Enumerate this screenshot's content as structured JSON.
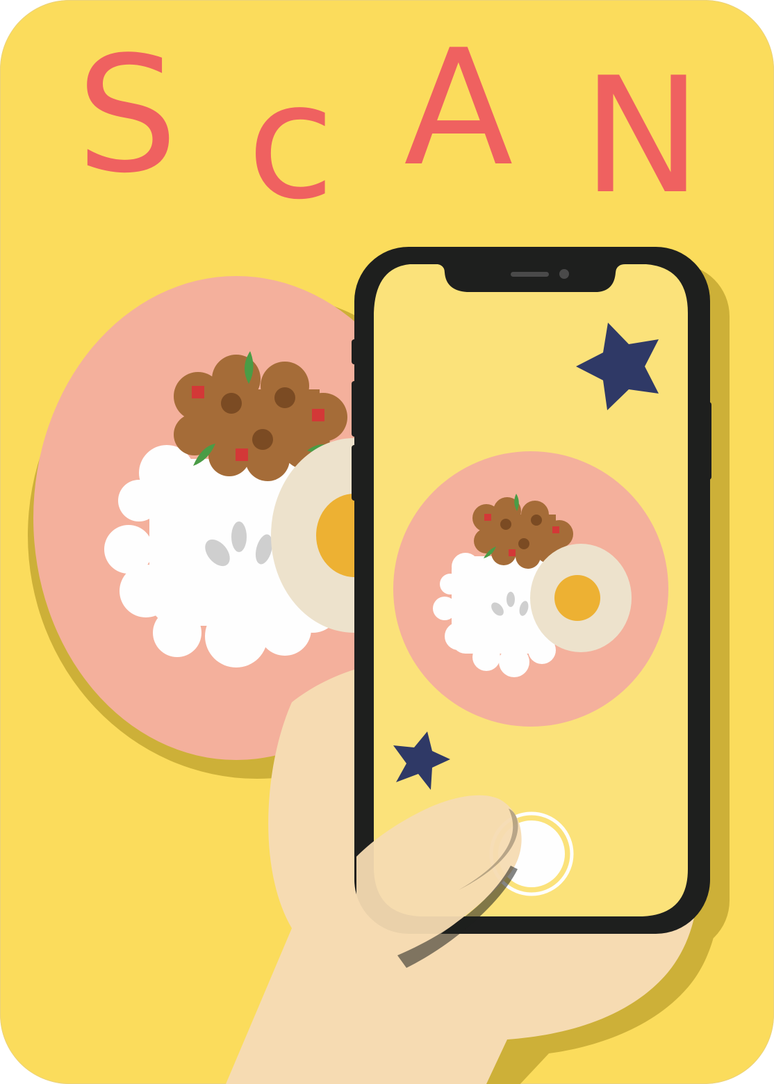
{
  "title": {
    "text": "SCAN",
    "letters": [
      "S",
      "c",
      "A",
      "N"
    ]
  },
  "colors": {
    "background": "#fbdc5c",
    "title": "#ef6160",
    "plate": "#f4b09c",
    "plate_shadow": "#cdb038",
    "rice": "#fefefe",
    "meat": "#a56c38",
    "egg_white": "#ede2cc",
    "egg_yolk": "#edb133",
    "phone_body": "#1e1f1e",
    "phone_screen": "#fbe27a",
    "star": "#2f3966",
    "hand": "#f6dbb2"
  },
  "icons": {
    "phone": "smartphone-icon",
    "plate": "food-plate-icon",
    "star": "star-icon",
    "hand": "hand-icon",
    "shutter": "shutter-button-icon"
  }
}
